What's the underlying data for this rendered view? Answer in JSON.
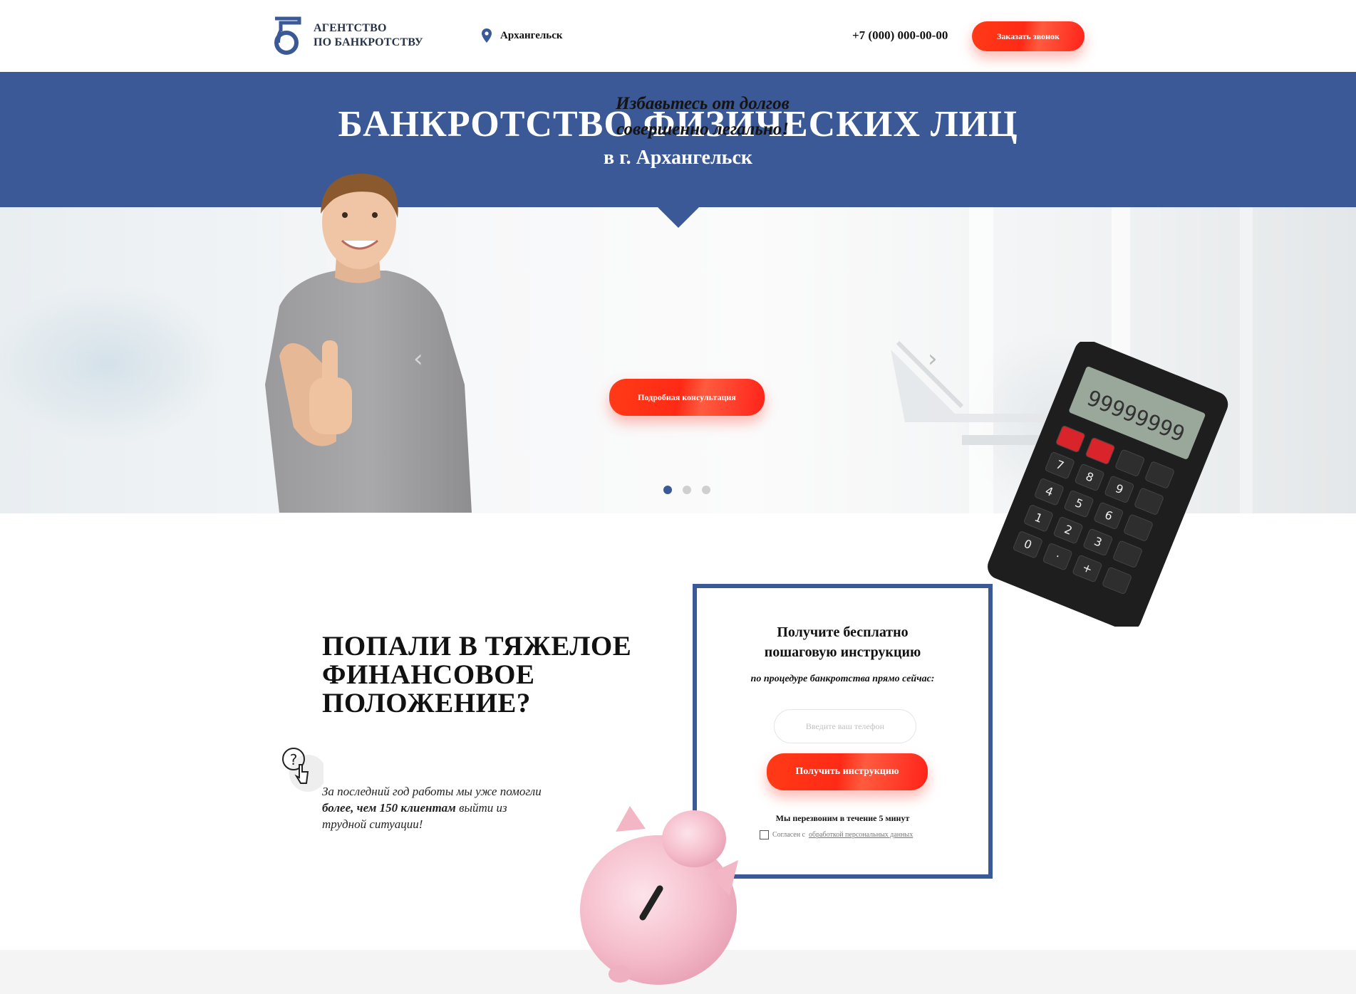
{
  "header": {
    "logo_line1": "АГЕНТСТВО",
    "logo_line2": "ПО БАНКРОТСТВУ",
    "city": "Архангельск",
    "phone": "+7 (000) 000-00-00",
    "callback_button": "Заказать звонок"
  },
  "hero": {
    "title": "БАНКРОТСТВО ФИЗИЧЕСКИХ ЛИЦ",
    "subtitle": "в г. Архангельск"
  },
  "slider": {
    "text_line1": "Избавьтесь от долгов",
    "text_line2": "совершенно легально!",
    "button": "Подробная консультация",
    "calculator_display": "99999999",
    "slides_total": 3,
    "active_slide": 1
  },
  "section": {
    "title_line1": "ПОПАЛИ В ТЯЖЕЛОЕ",
    "title_line2": "ФИНАНСОВОЕ",
    "title_line3": "ПОЛОЖЕНИЕ?",
    "text_part1": "За последний год работы мы уже помогли ",
    "text_bold": "более, чем 150 клиентам",
    "text_part2": " выйти из трудной ситуации!"
  },
  "form": {
    "title_line1": "Получите бесплатно",
    "title_line2": "пошаговую инструкцию",
    "subtitle": "по процедуре банкротства прямо сейчас:",
    "phone_placeholder": "Введите ваш телефон",
    "submit_button": "Получить инструкцию",
    "callback_note": "Мы перезвоним в течение 5 минут",
    "agree_prefix": "Согласен с ",
    "agree_link": "обработкой персональных данных"
  },
  "colors": {
    "brand_blue": "#3b5997",
    "accent_red": "#ff2a16"
  }
}
